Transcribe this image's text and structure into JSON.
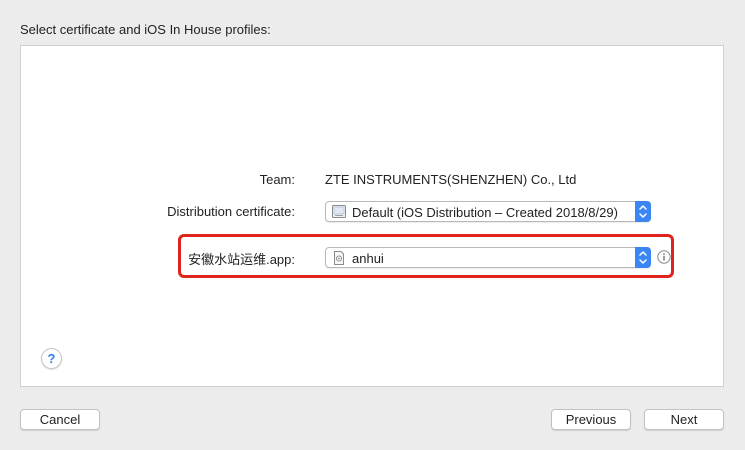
{
  "header": {
    "title": "Select certificate and iOS In House profiles:"
  },
  "form": {
    "team_label": "Team:",
    "team_value": "ZTE INSTRUMENTS(SHENZHEN) Co., Ltd",
    "cert_label": "Distribution certificate:",
    "cert_value": "Default (iOS Distribution – Created 2018/8/29)",
    "app_label": "安徽水站运维.app:",
    "app_profile_value": "anhui"
  },
  "footer": {
    "help_label": "?",
    "cancel_label": "Cancel",
    "previous_label": "Previous",
    "next_label": "Next"
  },
  "colors": {
    "accent": "#3a86f5",
    "highlight": "#e1231e"
  },
  "icons": {
    "cert": "certificate-icon",
    "profile": "provisioning-profile-icon",
    "info": "info-icon",
    "stepper": "up-down-chevron-icon"
  }
}
